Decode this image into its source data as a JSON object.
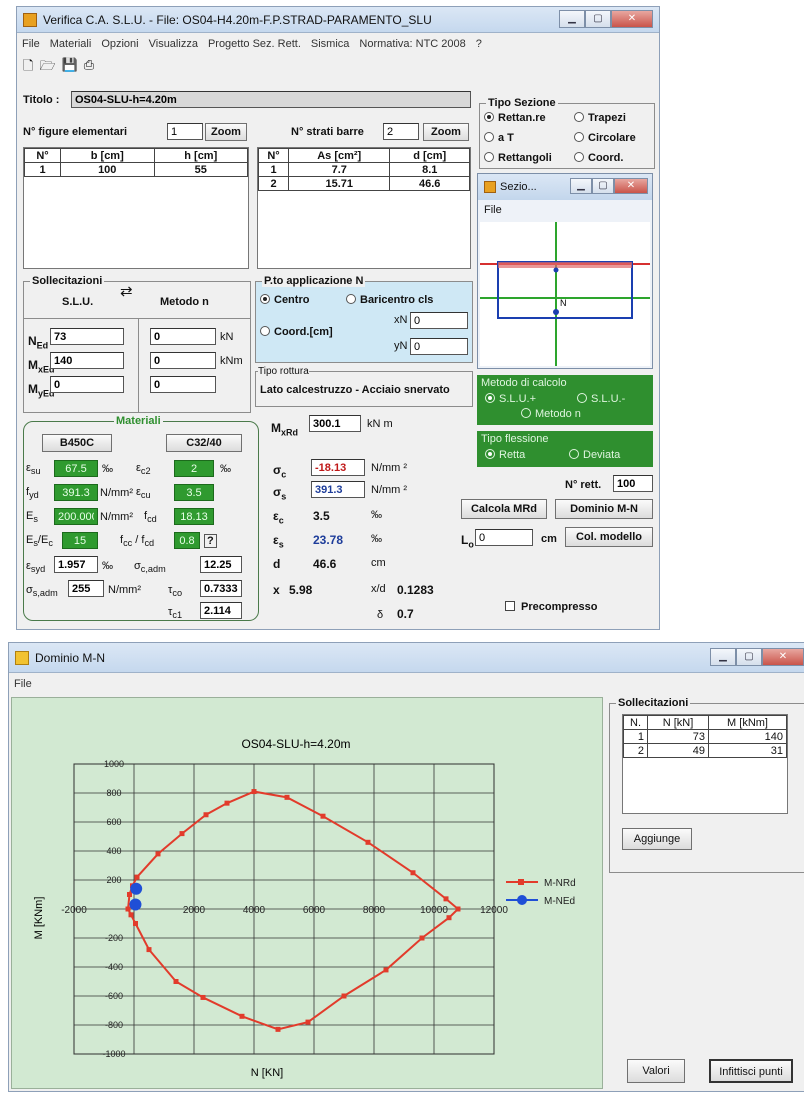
{
  "top_window": {
    "title": "Verifica C.A. S.L.U. - File: OS04-H4.20m-F.P.STRAD-PARAMENTO_SLU",
    "menu": [
      "File",
      "Materiali",
      "Opzioni",
      "Visualizza",
      "Progetto Sez. Rett.",
      "Sismica",
      "Normativa: NTC 2008",
      "?"
    ],
    "titolo_label": "Titolo :",
    "titolo_value": "OS04-SLU-h=4.20m",
    "figure_label": "N° figure elementari",
    "figure_value": "1",
    "strati_label": "N° strati barre",
    "strati_value": "2",
    "zoom_label": "Zoom",
    "figure_table": {
      "headers": [
        "N°",
        "b [cm]",
        "h [cm]"
      ],
      "rows": [
        [
          "1",
          "100",
          "55"
        ]
      ]
    },
    "bars_table": {
      "headers": [
        "N°",
        "As [cm²]",
        "d [cm]"
      ],
      "rows": [
        [
          "1",
          "7.7",
          "8.1"
        ],
        [
          "2",
          "15.71",
          "46.6"
        ]
      ]
    },
    "tipo_sezione": {
      "title": "Tipo Sezione",
      "options": [
        "Rettan.re",
        "Trapezi",
        "a T",
        "Circolare",
        "Rettangoli",
        "Coord."
      ],
      "selected": "Rettan.re"
    },
    "sollecitazioni": {
      "title": "Sollecitazioni",
      "slu": "S.L.U.",
      "metodo": "Metodo n",
      "rows": [
        {
          "label": "N",
          "sub": "Ed",
          "v1": "73",
          "v2": "0",
          "unit": "kN"
        },
        {
          "label": "M",
          "sub": "xEd",
          "v1": "140",
          "v2": "0",
          "unit": "kNm"
        },
        {
          "label": "M",
          "sub": "yEd",
          "v1": "0",
          "v2": "0",
          "unit": ""
        }
      ]
    },
    "punto_applicazione": {
      "title": "P.to applicazione N",
      "centro": "Centro",
      "baricentro": "Baricentro cls",
      "coord": "Coord.[cm]",
      "xN_label": "xN",
      "xN": "0",
      "yN_label": "yN",
      "yN": "0"
    },
    "tipo_rottura": {
      "title": "Tipo rottura",
      "value": "Lato calcestruzzo - Acciaio snervato"
    },
    "sezione_window": {
      "title": "Sezio...",
      "menu": "File",
      "label_N": "N"
    },
    "metodo_calcolo": {
      "title": "Metodo di calcolo",
      "opt1": "S.L.U.+",
      "opt2": "S.L.U.-",
      "opt3": "Metodo n"
    },
    "tipo_flessione": {
      "title": "Tipo flessione",
      "opt1": "Retta",
      "opt2": "Deviata"
    },
    "n_rett_label": "N° rett.",
    "n_rett_value": "100",
    "calcola_btn": "Calcola MRd",
    "dominio_btn": "Dominio M-N",
    "lo_label": "L",
    "lo_value": "0",
    "cm_label": "cm",
    "col_modello_btn": "Col. modello",
    "precompresso": "Precompresso",
    "materiali": {
      "title": "Materiali",
      "steel": "B450C",
      "concrete": "C32/40",
      "esu": "67.5",
      "esu_unit": "‰",
      "ec2": "2",
      "ec2_unit": "‰",
      "fyd": "391.3",
      "fyd_unit": "N/mm²",
      "ecu": "3.5",
      "es": "200.000",
      "es_unit": "N/mm²",
      "fcd": "18.13",
      "esec": "15",
      "fccfcd": "0.8",
      "fcc_q": "?",
      "esyd": "1.957",
      "esyd_unit": "‰",
      "sc_adm": "12.25",
      "ss_adm": "255",
      "ss_unit": "N/mm²",
      "tco": "0.7333",
      "tc1": "2.114"
    },
    "results": {
      "mxrd": "300.1",
      "mxrd_unit": "kN m",
      "sigma_c": "-18.13",
      "sigma_s": "391.3",
      "stress_unit": "N/mm ²",
      "eps_c": "3.5",
      "eps_s": "23.78",
      "eps_unit": "‰",
      "d": "46.6",
      "d_unit": "cm",
      "x": "5.98",
      "xd_label": "x/d",
      "xd": "0.1283",
      "delta": "0.7"
    }
  },
  "bottom_window": {
    "title": "Dominio M-N",
    "menu": "File",
    "sollecitazioni_title": "Sollecitazioni",
    "table_headers": [
      "N.",
      "N [kN]",
      "M [kNm]"
    ],
    "table_rows": [
      [
        "1",
        "73",
        "140"
      ],
      [
        "2",
        "49",
        "31"
      ]
    ],
    "aggiunge_btn": "Aggiunge",
    "valori_btn": "Valori",
    "infittisci_btn": "Infittisci punti"
  },
  "chart_data": {
    "type": "line",
    "title": "OS04-SLU-h=4.20m",
    "xlabel": "N [KN]",
    "ylabel": "M [KNm]",
    "xlim": [
      -2000,
      12000
    ],
    "ylim": [
      -1000,
      1000
    ],
    "xticks": [
      -2000,
      0,
      2000,
      4000,
      6000,
      8000,
      10000,
      12000
    ],
    "xtick_labels": [
      "-2000",
      "",
      "2000",
      "4000",
      "6000",
      "8000",
      "10000",
      "12000"
    ],
    "yticks": [
      1000,
      800,
      600,
      400,
      200,
      0,
      -200,
      -400,
      -600,
      -800,
      -1000
    ],
    "ytick_labels": [
      "1000",
      "800",
      "600",
      "400",
      "200",
      "",
      "-200",
      "-400",
      "-600",
      "-800",
      "-1000"
    ],
    "grid": true,
    "legend_position": "right",
    "series": [
      {
        "name": "M-NRd",
        "color": "#e23b2b",
        "points": [
          [
            -200,
            0
          ],
          [
            -150,
            100
          ],
          [
            -50,
            160
          ],
          [
            100,
            220
          ],
          [
            800,
            380
          ],
          [
            1600,
            520
          ],
          [
            2400,
            650
          ],
          [
            3100,
            730
          ],
          [
            4000,
            810
          ],
          [
            5100,
            770
          ],
          [
            6300,
            640
          ],
          [
            7800,
            460
          ],
          [
            9300,
            250
          ],
          [
            10400,
            70
          ],
          [
            10800,
            0
          ],
          [
            10500,
            -60
          ],
          [
            9600,
            -200
          ],
          [
            8400,
            -420
          ],
          [
            7000,
            -600
          ],
          [
            5800,
            -780
          ],
          [
            4800,
            -830
          ],
          [
            3600,
            -740
          ],
          [
            2300,
            -610
          ],
          [
            1400,
            -500
          ],
          [
            500,
            -280
          ],
          [
            50,
            -100
          ],
          [
            -100,
            -40
          ],
          [
            -200,
            0
          ]
        ]
      },
      {
        "name": "M-NEd",
        "color": "#1f4fd6",
        "points": [
          [
            73,
            140
          ],
          [
            49,
            31
          ]
        ]
      }
    ]
  }
}
